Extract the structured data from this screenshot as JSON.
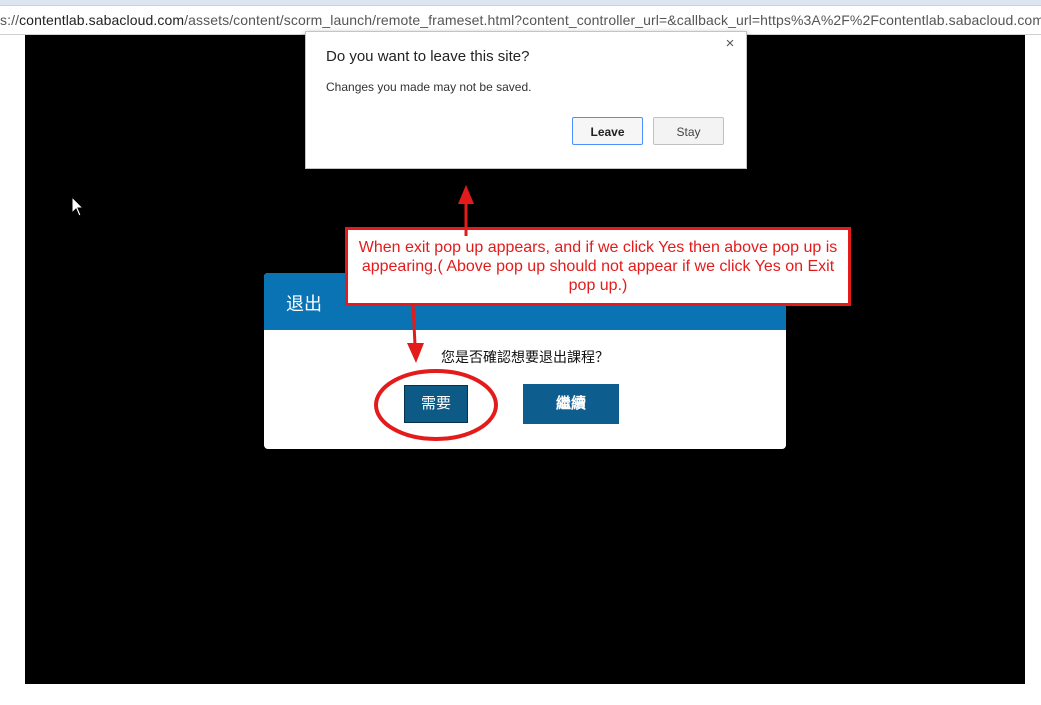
{
  "browser": {
    "url_prefix": "s://",
    "url_host": "contentlab.sabacloud.com",
    "url_rest": "/assets/content/scorm_launch/remote_frameset.html?content_controller_url=&callback_url=https%3A%2F%2Fcontentlab.sabacloud.com%2F"
  },
  "leave_dialog": {
    "title": "Do you want to leave this site?",
    "message": "Changes you made may not be saved.",
    "close_icon": "×",
    "leave_label": "Leave",
    "stay_label": "Stay"
  },
  "exit_dialog": {
    "title": "退出",
    "question": "您是否確認想要退出課程？",
    "yes_label": "需要",
    "continue_label": "繼續",
    "header_color": "#0a73b4"
  },
  "annotation": {
    "note": "When exit pop up appears, and if we click Yes then above pop up is appearing.( Above pop up should not appear if we click Yes on Exit pop up.)",
    "color": "#e41b1b"
  },
  "icons": {
    "cursor": "mouse-pointer-icon",
    "close": "close-icon"
  }
}
